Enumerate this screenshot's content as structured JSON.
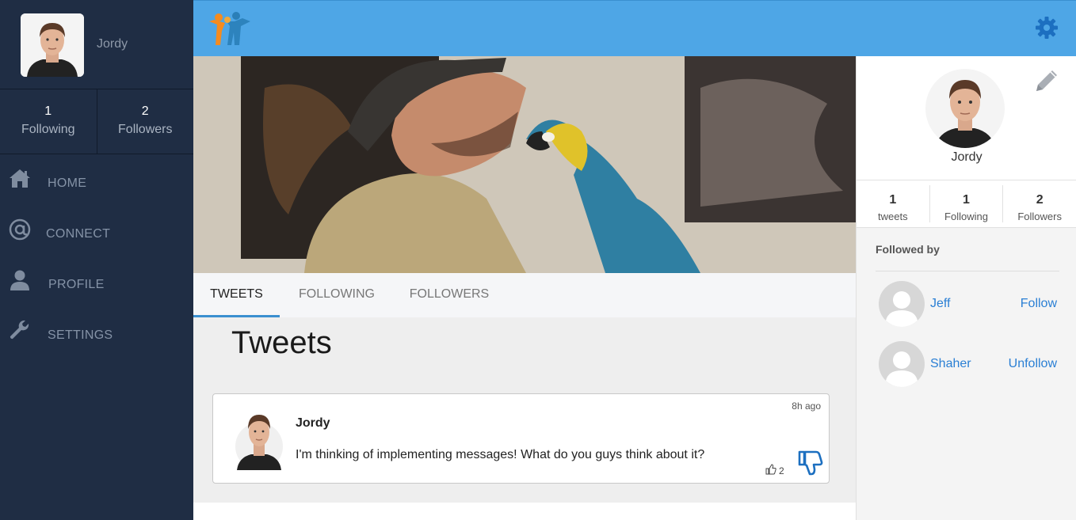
{
  "sidebar": {
    "username": "Jordy",
    "stats": [
      {
        "value": "1",
        "label": "Following"
      },
      {
        "value": "2",
        "label": "Followers"
      }
    ],
    "nav": [
      {
        "label": "HOME",
        "icon": "home-icon"
      },
      {
        "label": "CONNECT",
        "icon": "at-icon"
      },
      {
        "label": "PROFILE",
        "icon": "user-icon"
      },
      {
        "label": "SETTINGS",
        "icon": "wrench-icon"
      }
    ]
  },
  "topbar": {
    "logo": "people-logo",
    "settings_icon": "gear-icon"
  },
  "tabs": [
    {
      "label": "TWEETS",
      "active": true
    },
    {
      "label": "FOLLOWING",
      "active": false
    },
    {
      "label": "FOLLOWERS",
      "active": false
    }
  ],
  "feed": {
    "title": "Tweets",
    "tweets": [
      {
        "author": "Jordy",
        "time": "8h ago",
        "text": "I'm thinking of implementing messages! What do you guys think about it?",
        "likes": "2"
      }
    ]
  },
  "right_panel": {
    "name": "Jordy",
    "stats": [
      {
        "value": "1",
        "label": "tweets"
      },
      {
        "value": "1",
        "label": "Following"
      },
      {
        "value": "2",
        "label": "Followers"
      }
    ],
    "followed_by_title": "Followed by",
    "followed_by": [
      {
        "name": "Jeff",
        "action": "Follow"
      },
      {
        "name": "Shaher",
        "action": "Unfollow"
      }
    ]
  },
  "colors": {
    "sidebar": "#1f2d44",
    "topbar": "#4ea6e6",
    "accent": "#2a7fd4",
    "gear": "#1c6fc0"
  }
}
